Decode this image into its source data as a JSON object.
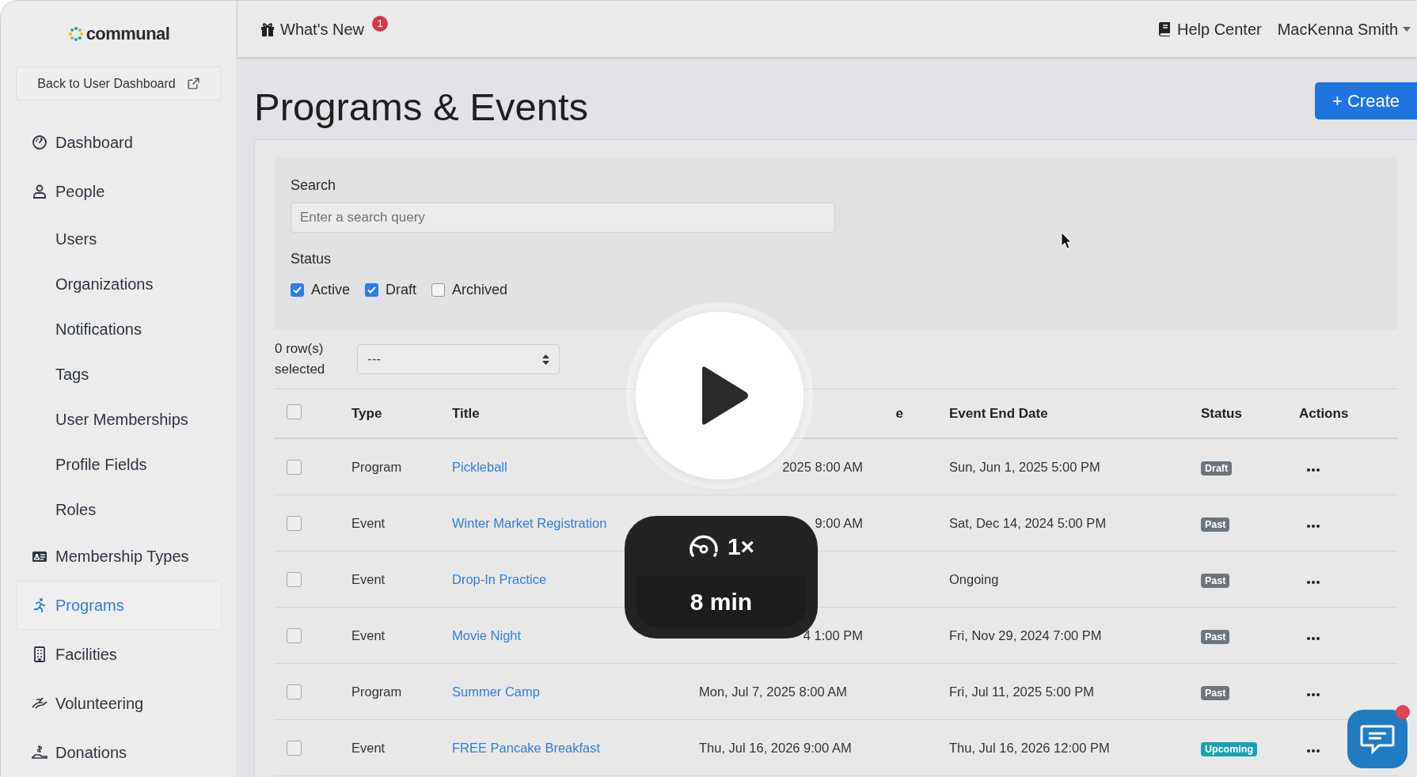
{
  "logo": "communal",
  "back_button": "Back to User Dashboard",
  "nav": [
    {
      "label": "Dashboard",
      "kind": "main",
      "selected": false
    },
    {
      "label": "People",
      "kind": "main",
      "selected": false
    },
    {
      "label": "Users",
      "kind": "sub",
      "selected": false
    },
    {
      "label": "Organizations",
      "kind": "sub",
      "selected": false
    },
    {
      "label": "Notifications",
      "kind": "sub",
      "selected": false
    },
    {
      "label": "Tags",
      "kind": "sub",
      "selected": false
    },
    {
      "label": "User Memberships",
      "kind": "sub",
      "selected": false
    },
    {
      "label": "Profile Fields",
      "kind": "sub",
      "selected": false
    },
    {
      "label": "Roles",
      "kind": "sub",
      "selected": false
    },
    {
      "label": "Membership Types",
      "kind": "main",
      "selected": false
    },
    {
      "label": "Programs",
      "kind": "main",
      "selected": true
    },
    {
      "label": "Facilities",
      "kind": "main",
      "selected": false
    },
    {
      "label": "Volunteering",
      "kind": "main",
      "selected": false
    },
    {
      "label": "Donations",
      "kind": "main",
      "selected": false
    }
  ],
  "topbar": {
    "whats_new": "What's New",
    "badge": "1",
    "help_center": "Help Center",
    "user": "MacKenna Smith"
  },
  "page": {
    "title": "Programs & Events",
    "create_button": "+ Create"
  },
  "filters": {
    "search_label": "Search",
    "placeholder": "Enter a search query",
    "status_label": "Status",
    "statuses": [
      {
        "label": "Active",
        "checked": true
      },
      {
        "label": "Draft",
        "checked": true
      },
      {
        "label": "Archived",
        "checked": false
      }
    ]
  },
  "select_all": {
    "checked": false
  },
  "selection": {
    "count": "0 row(s) selected",
    "bulk_action": "---"
  },
  "table": {
    "columns": [
      {
        "label": "Type",
        "cut": false
      },
      {
        "label": "Title",
        "cut": false
      },
      {
        "label": "e",
        "cut": true
      },
      {
        "label": "Event End Date",
        "cut": false
      },
      {
        "label": "Status",
        "cut": false
      },
      {
        "label": "Actions",
        "cut": false
      }
    ],
    "rows": [
      {
        "type": "Program",
        "title": "Pickleball",
        "start": "2025 8:00 AM",
        "start_cut": true,
        "end": "Sun, Jun 1, 2025 5:00 PM",
        "status": "Draft",
        "color": "#6c757d",
        "selected": false
      },
      {
        "type": "Event",
        "title": "Winter Market Registration",
        "start": "9:00 AM",
        "start_cut": true,
        "end": "Sat, Dec 14, 2024 5:00 PM",
        "status": "Past",
        "color": "#6c757d",
        "selected": false
      },
      {
        "type": "Event",
        "title": "Drop-In Practice",
        "end": "Ongoing",
        "status": "Past",
        "color": "#6c757d",
        "selected": false
      },
      {
        "type": "Event",
        "title": "Movie Night",
        "start": "4 1:00 PM",
        "start_cut": true,
        "end": "Fri, Nov 29, 2024 7:00 PM",
        "status": "Past",
        "color": "#6c757d",
        "selected": false
      },
      {
        "type": "Program",
        "title": "Summer Camp",
        "start": "Mon, Jul 7, 2025 8:00 AM",
        "start_cut": false,
        "end": "Fri, Jul 11, 2025 5:00 PM",
        "status": "Past",
        "color": "#6c757d",
        "selected": false
      },
      {
        "type": "Event",
        "title": "FREE Pancake Breakfast",
        "start": "Thu, Jul 16, 2026 9:00 AM",
        "start_cut": false,
        "end": "Thu, Jul 16, 2026 12:00 PM",
        "status": "Upcoming",
        "color": "#17a2b8",
        "selected": false
      }
    ]
  },
  "player": {
    "speed": "1×",
    "duration": "8 min"
  }
}
